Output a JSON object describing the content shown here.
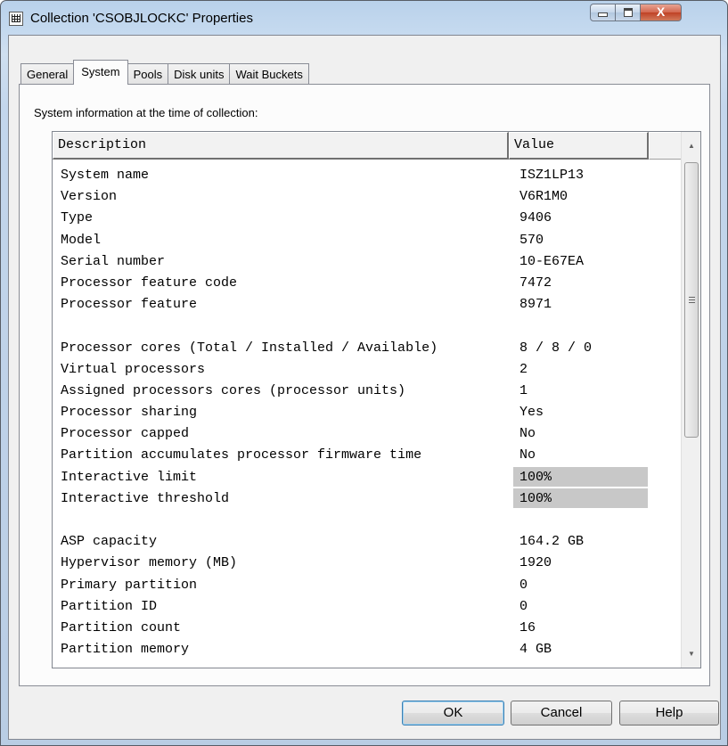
{
  "window": {
    "title": "Collection 'CSOBJLOCKC' Properties",
    "controls": {
      "minimize": "",
      "maximize": "",
      "close": "X"
    }
  },
  "tabs": [
    {
      "label": "General",
      "active": false
    },
    {
      "label": "System",
      "active": true
    },
    {
      "label": "Pools",
      "active": false
    },
    {
      "label": "Disk units",
      "active": false
    },
    {
      "label": "Wait Buckets",
      "active": false
    }
  ],
  "system": {
    "info_label": "System information at the time of collection:",
    "columns": {
      "description": "Description",
      "value": "Value"
    },
    "rows": [
      {
        "d": "System name",
        "v": "ISZ1LP13"
      },
      {
        "d": "Version",
        "v": "V6R1M0"
      },
      {
        "d": "Type",
        "v": "9406"
      },
      {
        "d": "Model",
        "v": "570"
      },
      {
        "d": "Serial number",
        "v": "10-E67EA"
      },
      {
        "d": "Processor feature code",
        "v": "7472"
      },
      {
        "d": "Processor feature",
        "v": "8971"
      },
      {
        "d": "",
        "v": ""
      },
      {
        "d": "Processor cores (Total / Installed / Available)",
        "v": "8 / 8 / 0"
      },
      {
        "d": "Virtual processors",
        "v": "2"
      },
      {
        "d": "Assigned processors cores (processor units)",
        "v": "1"
      },
      {
        "d": "Processor sharing",
        "v": "Yes"
      },
      {
        "d": "Processor capped",
        "v": "No"
      },
      {
        "d": "Partition accumulates processor firmware time",
        "v": "No"
      },
      {
        "d": "Interactive limit",
        "v": "100%",
        "highlight": true
      },
      {
        "d": "Interactive threshold",
        "v": "100%",
        "highlight": true
      },
      {
        "d": "",
        "v": ""
      },
      {
        "d": "ASP capacity",
        "v": "164.2 GB"
      },
      {
        "d": "Hypervisor memory (MB)",
        "v": "1920"
      },
      {
        "d": "Primary partition",
        "v": "0"
      },
      {
        "d": "Partition ID",
        "v": "0"
      },
      {
        "d": "Partition count",
        "v": "16"
      },
      {
        "d": "Partition memory",
        "v": "4 GB"
      }
    ]
  },
  "buttons": {
    "ok": "OK",
    "cancel": "Cancel",
    "help": "Help"
  },
  "scrollbar": {
    "up": "▲",
    "down": "▼"
  }
}
